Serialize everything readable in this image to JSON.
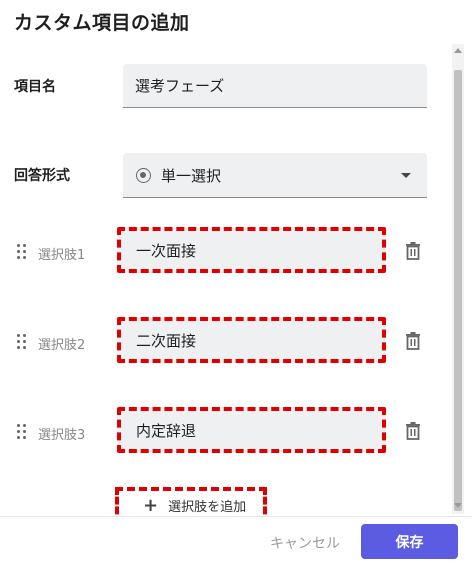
{
  "dialog": {
    "title": "カスタム項目の追加"
  },
  "form": {
    "name_label": "項目名",
    "name_value": "選考フェーズ",
    "format_label": "回答形式",
    "format_value": "単一選択"
  },
  "options": [
    {
      "label": "選択肢1",
      "value": "一次面接"
    },
    {
      "label": "選択肢2",
      "value": "二次面接"
    },
    {
      "label": "選択肢3",
      "value": "内定辞退"
    }
  ],
  "add_option_label": "選択肢を追加",
  "footer": {
    "cancel_label": "キャンセル",
    "save_label": "保存"
  },
  "colors": {
    "accent": "#5b5ce2",
    "highlight": "#e00000"
  },
  "icons": [
    "radio-icon",
    "chevron-down-icon",
    "drag-handle-icon",
    "trash-icon",
    "plus-icon"
  ]
}
